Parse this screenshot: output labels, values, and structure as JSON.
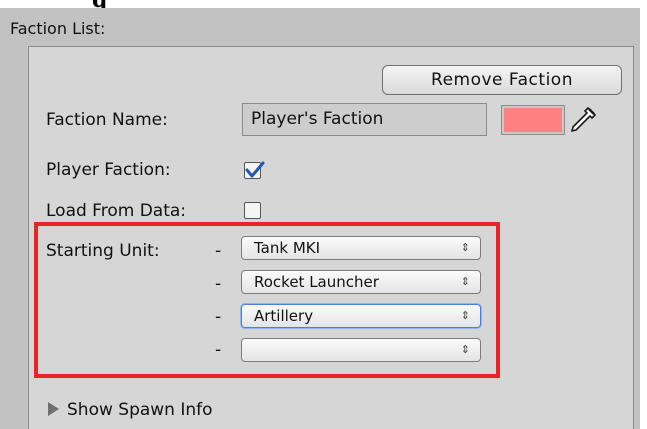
{
  "page_heading_partial": "g",
  "section_header": "Faction List:",
  "remove_button": "Remove Faction",
  "faction_name": {
    "label": "Faction Name:",
    "value": "Player's Faction"
  },
  "faction_color": "#fe8080",
  "player_faction": {
    "label": "Player Faction:",
    "checked": true
  },
  "load_from_data": {
    "label": "Load From Data:",
    "checked": false
  },
  "starting_units": {
    "label": "Starting Unit:",
    "dash": "-",
    "items": [
      {
        "value": "Tank MKI"
      },
      {
        "value": "Rocket Launcher"
      },
      {
        "value": "Artillery"
      },
      {
        "value": ""
      }
    ]
  },
  "dropdown_arrow": "⇕",
  "foldout": {
    "label": "Show Spawn Info"
  },
  "highlight_color": "#e8232a"
}
